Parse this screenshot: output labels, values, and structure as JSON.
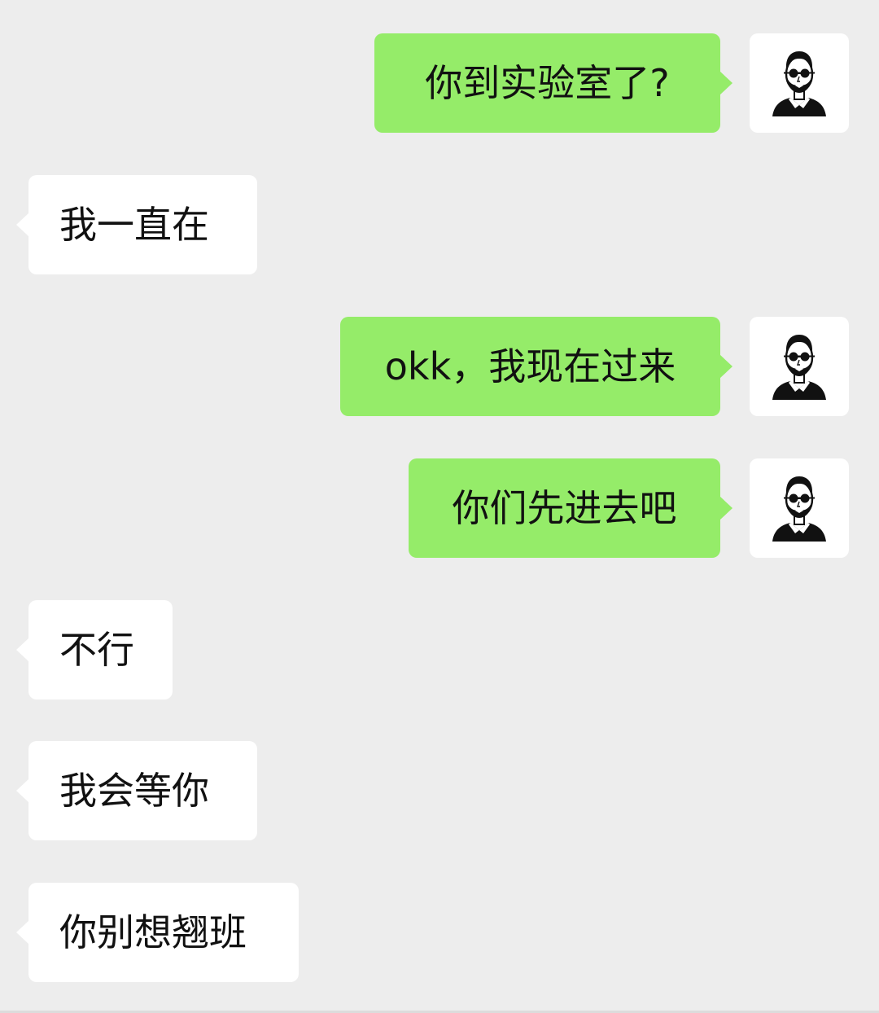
{
  "colors": {
    "background": "#ededed",
    "outgoing_bubble": "#95ec69",
    "incoming_bubble": "#ffffff",
    "text": "#111111"
  },
  "avatar": {
    "icon": "bearded-man-sunglasses-icon"
  },
  "messages": [
    {
      "side": "outgoing",
      "text": "你到实验室了?"
    },
    {
      "side": "incoming",
      "text": "我一直在"
    },
    {
      "side": "outgoing",
      "text": "okk，我现在过来"
    },
    {
      "side": "outgoing",
      "text": "你们先进去吧"
    },
    {
      "side": "incoming",
      "text": "不行"
    },
    {
      "side": "incoming",
      "text": "我会等你"
    },
    {
      "side": "incoming",
      "text": "你别想翘班"
    }
  ]
}
